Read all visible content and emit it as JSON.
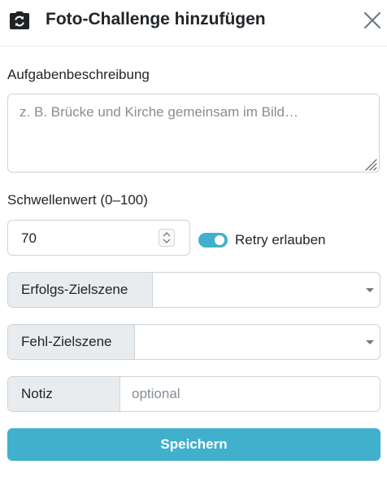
{
  "header": {
    "title": "Foto-Challenge hinzufügen",
    "title_icon": "camera-rotate-icon",
    "close_icon": "close-icon"
  },
  "form": {
    "description": {
      "label": "Aufgabenbeschreibung",
      "placeholder": "z. B. Brücke und Kirche gemeinsam im Bild…",
      "value": ""
    },
    "threshold": {
      "label": "Schwellenwert (0–100)",
      "value": "70"
    },
    "retry": {
      "label": "Retry erlauben",
      "checked": true
    },
    "success_scene": {
      "label": "Erfolgs-Zielszene",
      "selected": ""
    },
    "fail_scene": {
      "label": "Fehl-Zielszene",
      "selected": ""
    },
    "note": {
      "label": "Notiz",
      "placeholder": "optional",
      "value": ""
    },
    "save_label": "Speichern"
  },
  "colors": {
    "accent": "#41b0cc",
    "addon_bg": "#e9ecef",
    "border": "#ced4da"
  }
}
